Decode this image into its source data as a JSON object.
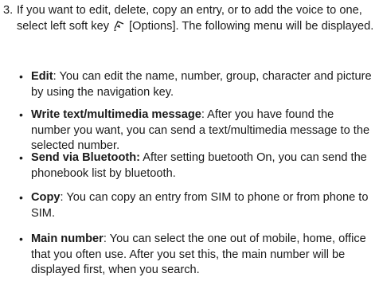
{
  "step": {
    "number": "3.",
    "text_before_icon": "If you want to edit, delete, copy an entry, or to add the voice to one, select left soft key",
    "icon": "left-soft-key-icon",
    "text_after_icon": "[Options]. The following menu will be displayed."
  },
  "options": [
    {
      "term": "Edit",
      "sep": ": ",
      "desc": "You can edit the name, number, group, character and picture by using the navigation key."
    },
    {
      "term": "Write text/multimedia message",
      "sep": ": ",
      "desc": "After you have found the number you want, you can send a text/multimedia message to the selected number."
    },
    {
      "term": "Send via Bluetooth:",
      "sep": " ",
      "desc": "After setting buetooth On, you can send the phonebook list by bluetooth."
    },
    {
      "term": "Copy",
      "sep": ": ",
      "desc": "You can copy an entry from SIM to phone or from phone to SIM."
    },
    {
      "term": "Main number",
      "sep": ": ",
      "desc": "You can select the one out of mobile, home, office that you often use. After you set this, the main number will be displayed first, when you search."
    }
  ]
}
